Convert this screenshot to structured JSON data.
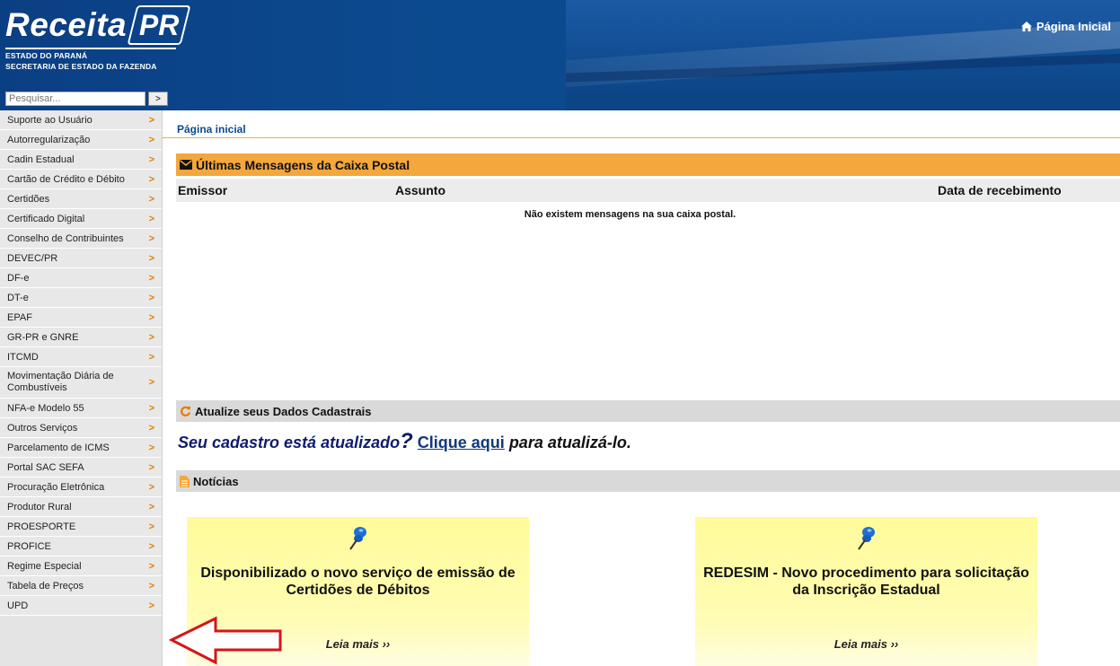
{
  "header": {
    "logo_main": "Receita",
    "logo_pr": "PR",
    "logo_sub_1": "ESTADO DO PARANÁ",
    "logo_sub_2": "SECRETARIA DE ESTADO DA FAZENDA",
    "home_label": "Página Inicial",
    "search_placeholder": "Pesquisar...",
    "search_button": ">"
  },
  "sidebar": {
    "items": [
      {
        "label": "Suporte ao Usuário"
      },
      {
        "label": "Autorregularização"
      },
      {
        "label": "Cadin Estadual"
      },
      {
        "label": "Cartão de Crédito e Débito"
      },
      {
        "label": "Certidões"
      },
      {
        "label": "Certificado Digital"
      },
      {
        "label": "Conselho de Contribuintes"
      },
      {
        "label": "DEVEC/PR"
      },
      {
        "label": "DF-e"
      },
      {
        "label": "DT-e"
      },
      {
        "label": "EPAF"
      },
      {
        "label": "GR-PR e GNRE"
      },
      {
        "label": "ITCMD"
      },
      {
        "label": "Movimentação Diária de Combustíveis"
      },
      {
        "label": "NFA-e Modelo 55"
      },
      {
        "label": "Outros Serviços"
      },
      {
        "label": "Parcelamento de ICMS"
      },
      {
        "label": "Portal SAC SEFA"
      },
      {
        "label": "Procuração Eletrônica"
      },
      {
        "label": "Produtor Rural"
      },
      {
        "label": "PROESPORTE"
      },
      {
        "label": "PROFICE"
      },
      {
        "label": "Regime Especial"
      },
      {
        "label": "Tabela de Preços"
      },
      {
        "label": "UPD"
      }
    ],
    "chevron": ">"
  },
  "main": {
    "breadcrumb": "Página inicial",
    "mailbox": {
      "title": "Últimas Mensagens da Caixa Postal",
      "col_sender": "Emissor",
      "col_subject": "Assunto",
      "col_date": "Data de recebimento",
      "empty": "Não existem mensagens na sua caixa postal."
    },
    "update": {
      "title": "Atualize seus Dados Cadastrais",
      "question": "Seu cadastro está atualizado",
      "qmark": "?",
      "link": "Clique aqui",
      "tail": "para atualizá-lo."
    },
    "news": {
      "title": "Notícias",
      "items": [
        {
          "title": "Disponibilizado o novo serviço de emissão de Certidões de Débitos",
          "more": "Leia mais ››"
        },
        {
          "title": "REDESIM - Novo procedimento para solicitação da Inscrição Estadual",
          "more": "Leia mais ››"
        }
      ]
    }
  },
  "colors": {
    "header_blue": "#0b4a8e",
    "section_orange": "#f3a73c",
    "chevron_orange": "#e87b00",
    "annotation_red": "#d7141a"
  }
}
